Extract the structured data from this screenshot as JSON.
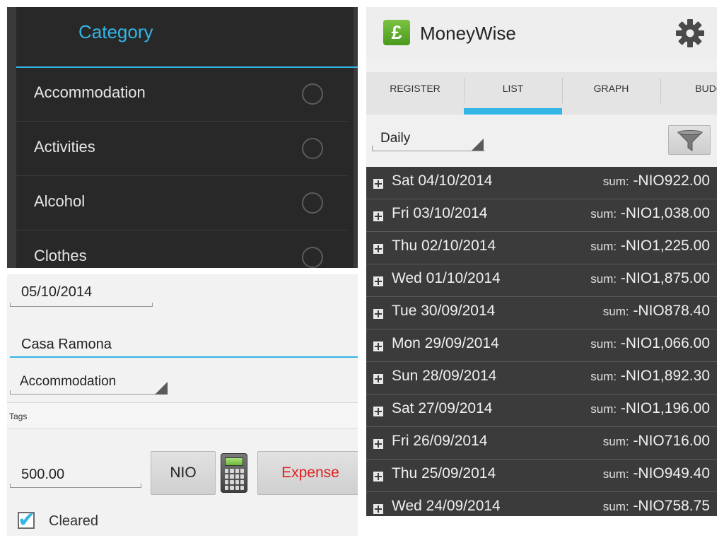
{
  "category_dialog": {
    "title": "Category",
    "items": [
      {
        "label": "Accommodation"
      },
      {
        "label": "Activities"
      },
      {
        "label": "Alcohol"
      },
      {
        "label": "Clothes"
      }
    ]
  },
  "form": {
    "date": "05/10/2014",
    "payee": "Casa Ramona",
    "category": "Accommodation",
    "tags_placeholder": "Tags",
    "amount": "500.00",
    "currency_button": "NIO",
    "type_button": "Expense",
    "type_color": "#e02020",
    "cleared_label": "Cleared",
    "cleared_checked": true
  },
  "moneywise": {
    "app_title": "MoneyWise",
    "logo_symbol": "£",
    "logo_icon": "pound-sign-icon",
    "settings_icon": "gear-icon",
    "tabs": [
      {
        "label": "REGISTER"
      },
      {
        "label": "LIST",
        "selected": true
      },
      {
        "label": "GRAPH"
      },
      {
        "label": "BUDG"
      }
    ],
    "period": "Daily",
    "filter_icon": "funnel-icon",
    "sum_label": "sum:",
    "rows": [
      {
        "date": "Sat 04/10/2014",
        "sum": "-NIO922.00"
      },
      {
        "date": "Fri 03/10/2014",
        "sum": "-NIO1,038.00"
      },
      {
        "date": "Thu 02/10/2014",
        "sum": "-NIO1,225.00"
      },
      {
        "date": "Wed 01/10/2014",
        "sum": "-NIO1,875.00"
      },
      {
        "date": "Tue 30/09/2014",
        "sum": "-NIO878.40"
      },
      {
        "date": "Mon 29/09/2014",
        "sum": "-NIO1,066.00"
      },
      {
        "date": "Sun 28/09/2014",
        "sum": "-NIO1,892.30"
      },
      {
        "date": "Sat 27/09/2014",
        "sum": "-NIO1,196.00"
      },
      {
        "date": "Fri 26/09/2014",
        "sum": "-NIO716.00"
      },
      {
        "date": "Thu 25/09/2014",
        "sum": "-NIO949.40"
      },
      {
        "date": "Wed 24/09/2014",
        "sum": "-NIO758.75"
      }
    ]
  },
  "colors": {
    "accent": "#33b5e5",
    "dark_row": "#3b3b3b",
    "logo_green": "#5aa82a"
  }
}
